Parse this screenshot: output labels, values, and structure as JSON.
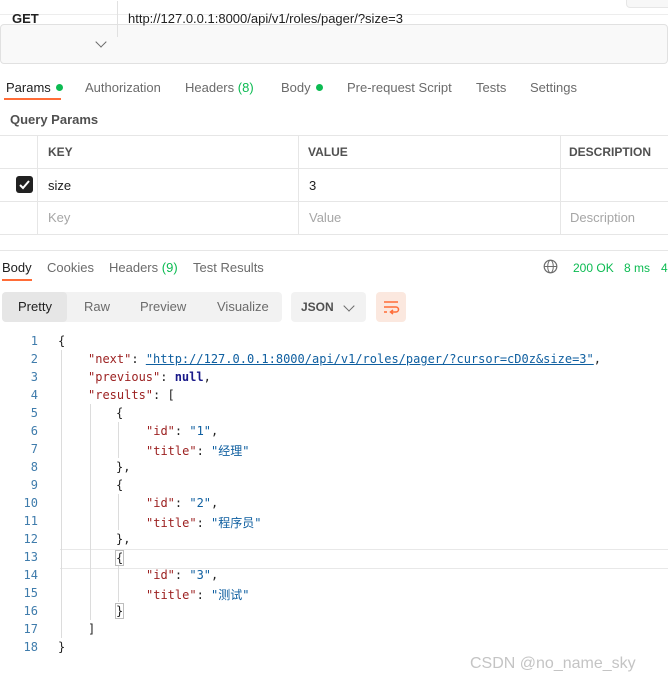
{
  "request": {
    "method": "GET",
    "url": "http://127.0.0.1:8000/api/v1/roles/pager/?size=3"
  },
  "request_tabs": [
    {
      "label": "Params",
      "dot": true,
      "active": true
    },
    {
      "label": "Authorization"
    },
    {
      "label": "Headers",
      "count": "(8)"
    },
    {
      "label": "Body",
      "dot": true
    },
    {
      "label": "Pre-request Script"
    },
    {
      "label": "Tests"
    },
    {
      "label": "Settings"
    }
  ],
  "query_params": {
    "title": "Query Params",
    "headers": [
      "KEY",
      "VALUE",
      "DESCRIPTION"
    ],
    "rows": [
      {
        "checked": true,
        "key": "size",
        "value": "3",
        "description": ""
      }
    ],
    "placeholders": {
      "key": "Key",
      "value": "Value",
      "description": "Description"
    }
  },
  "response_tabs": [
    {
      "label": "Body",
      "active": true
    },
    {
      "label": "Cookies"
    },
    {
      "label": "Headers",
      "count": "(9)"
    },
    {
      "label": "Test Results"
    }
  ],
  "response_meta": {
    "status": "200 OK",
    "time": "8 ms",
    "size_cut": "4"
  },
  "view_modes": [
    "Pretty",
    "Raw",
    "Preview",
    "Visualize"
  ],
  "format": "JSON",
  "icons": {
    "method_chevron": "chevron-down-icon",
    "globe": "globe-icon",
    "format_chevron": "chevron-down-icon",
    "wrap": "wrap-lines-icon",
    "checkbox": "checkbox-checked-icon"
  },
  "colors": {
    "accent": "#ff6c37",
    "success": "#0cbb52",
    "json_key": "#9c2121",
    "json_string": "#0f5fa0",
    "line_number": "#3f7cac"
  },
  "code": {
    "line_numbers": [
      "1",
      "2",
      "3",
      "4",
      "5",
      "6",
      "7",
      "8",
      "9",
      "10",
      "11",
      "12",
      "13",
      "14",
      "15",
      "16",
      "17",
      "18"
    ],
    "next_key": "\"next\"",
    "next_value": "\"http://127.0.0.1:8000/api/v1/roles/pager/?cursor=cD0z&size=3\"",
    "previous_key": "\"previous\"",
    "previous_value": "null",
    "results_key": "\"results\"",
    "items": [
      {
        "id": "\"1\"",
        "title": "\"经理\""
      },
      {
        "id": "\"2\"",
        "title": "\"程序员\""
      },
      {
        "id": "\"3\"",
        "title": "\"测试\""
      }
    ],
    "id_key": "\"id\"",
    "title_key": "\"title\""
  },
  "watermark": "CSDN @no_name_sky"
}
